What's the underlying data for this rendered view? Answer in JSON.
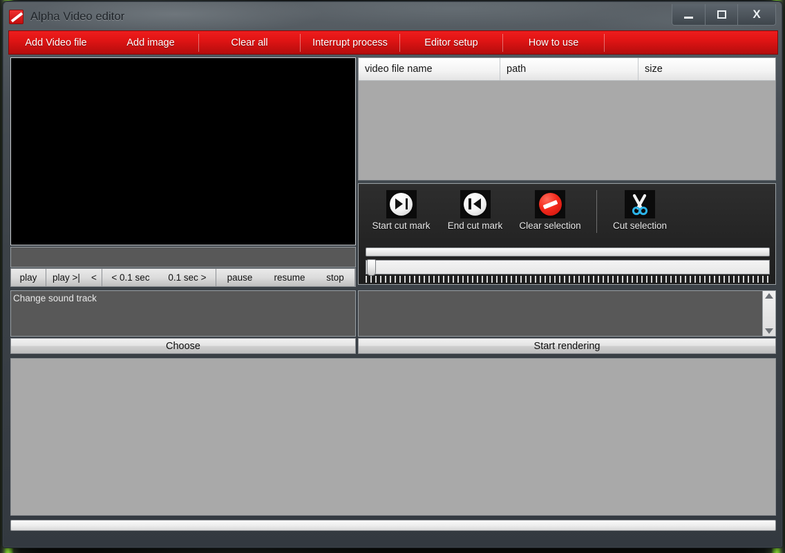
{
  "window": {
    "title": "Alpha Video editor",
    "icon": "app-logo-icon",
    "controls": {
      "minimize": "minimize-icon",
      "maximize": "maximize-icon",
      "close": "X"
    }
  },
  "menubar": {
    "items": [
      {
        "label": "Add Video file"
      },
      {
        "label": "Add image"
      },
      {
        "label": "Clear all"
      },
      {
        "label": "Interrupt process"
      },
      {
        "label": "Editor setup"
      },
      {
        "label": "How to use"
      }
    ]
  },
  "filelist": {
    "columns": [
      {
        "label": "video file name"
      },
      {
        "label": "path"
      },
      {
        "label": "size"
      }
    ],
    "rows": []
  },
  "playback": {
    "buttons": [
      {
        "label": "play"
      },
      {
        "label": "play >|"
      },
      {
        "label": "<"
      },
      {
        "label": "< 0.1 sec"
      },
      {
        "label": "0.1 sec >"
      },
      {
        "label": "pause"
      },
      {
        "label": "resume"
      },
      {
        "label": "stop"
      }
    ]
  },
  "soundtrack": {
    "label": "Change sound track",
    "choose_label": "Choose"
  },
  "cutpanel": {
    "tools": [
      {
        "label": "Start cut mark",
        "icon": "skip-to-end-icon"
      },
      {
        "label": "End cut mark",
        "icon": "skip-to-start-icon"
      },
      {
        "label": "Clear selection",
        "icon": "no-entry-icon"
      },
      {
        "label": "Cut selection",
        "icon": "scissors-icon"
      }
    ],
    "progress_percent": 0,
    "slider_position_percent": 0
  },
  "render": {
    "log": "",
    "start_label": "Start rendering"
  },
  "status": {
    "progress_percent": 0
  },
  "colors": {
    "menu_red": "#e01414",
    "accent_red": "#f42a1c",
    "panel_gray": "#a9a9a9",
    "dark_panel": "#585858",
    "titlebar": "#3c4248",
    "scissors_blue": "#2bb3e8"
  }
}
